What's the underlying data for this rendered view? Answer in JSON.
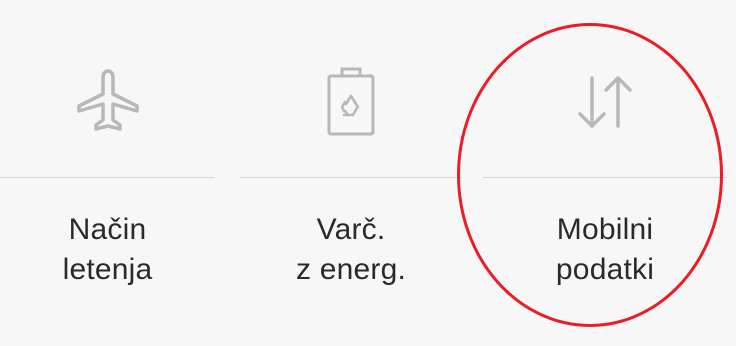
{
  "colors": {
    "background": "#f7f7f7",
    "icon": "#b8b8b8",
    "text": "#2a2a2a",
    "divider": "#d3d3d3",
    "highlight": "#ec1c24"
  },
  "quick_settings": {
    "tiles": [
      {
        "id": "airplane",
        "icon": "airplane-icon",
        "label_line1": "Način",
        "label_line2": "letenja"
      },
      {
        "id": "power-saving",
        "icon": "battery-recycle-icon",
        "label_line1": "Varč.",
        "label_line2": "z energ."
      },
      {
        "id": "mobile-data",
        "icon": "up-down-arrows-icon",
        "label_line1": "Mobilni",
        "label_line2": "podatki"
      }
    ]
  }
}
